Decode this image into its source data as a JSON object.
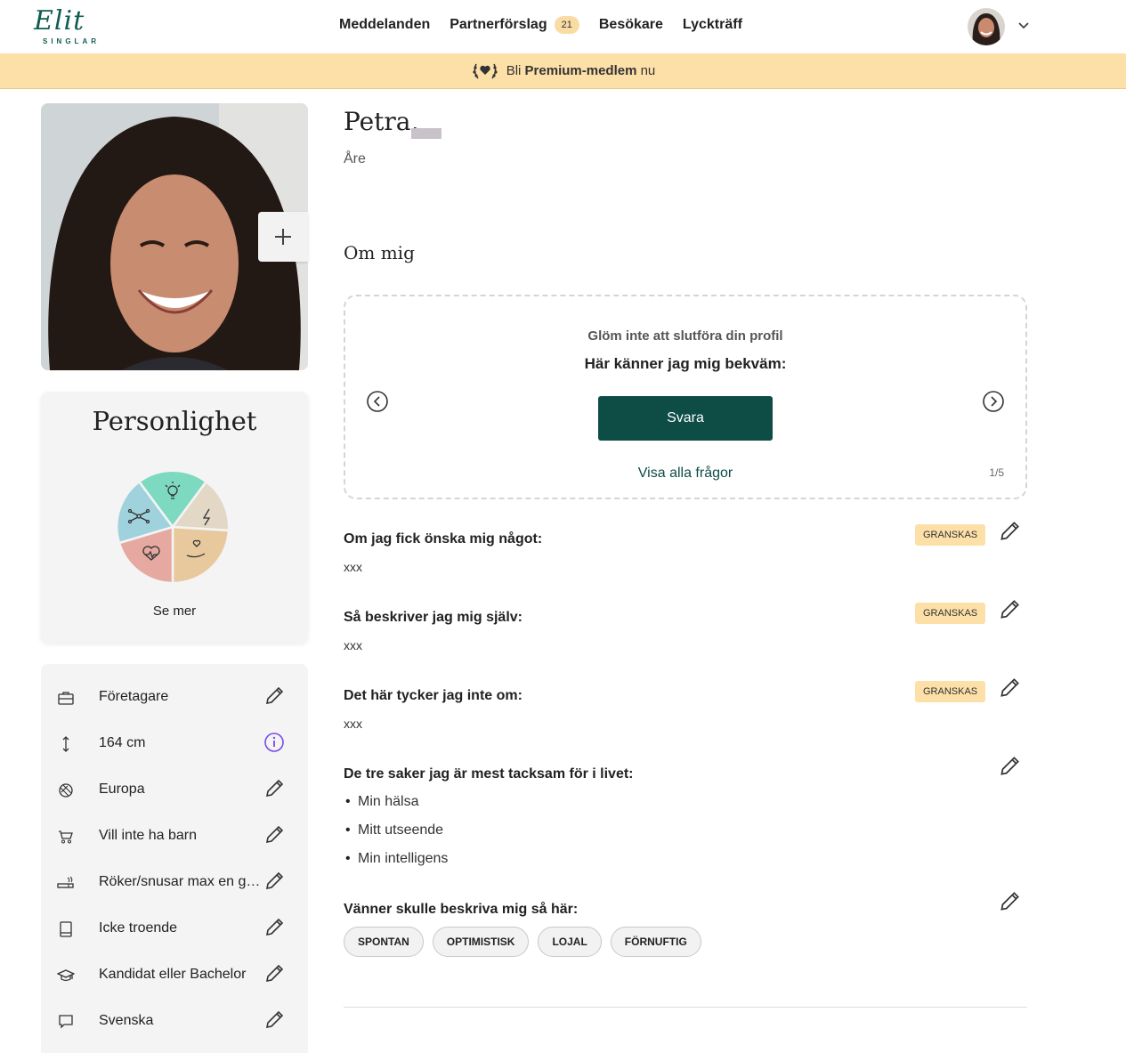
{
  "header": {
    "logo_text": "Elit",
    "logo_sub": "SINGLAR",
    "nav": [
      {
        "label": "Meddelanden"
      },
      {
        "label": "Partnerförslag",
        "badge": "21"
      },
      {
        "label": "Besökare"
      },
      {
        "label": "Lyckträff"
      }
    ]
  },
  "premium": {
    "prefix": "Bli",
    "bold": "Premium-medlem",
    "suffix": "nu"
  },
  "profile": {
    "name": "Petra,",
    "city": "Åre"
  },
  "personality": {
    "title": "Personlighet",
    "see_more": "Se mer"
  },
  "facts": [
    {
      "icon": "briefcase-icon",
      "label": "Företagare",
      "action": "edit"
    },
    {
      "icon": "height-icon",
      "label": "164 cm",
      "action": "info"
    },
    {
      "icon": "globe-icon",
      "label": "Europa",
      "action": "edit"
    },
    {
      "icon": "stroller-icon",
      "label": "Vill inte ha barn",
      "action": "edit"
    },
    {
      "icon": "cigarette-icon",
      "label": "Röker/snusar max en gång i veckan",
      "action": "edit"
    },
    {
      "icon": "book-icon",
      "label": "Icke troende",
      "action": "edit"
    },
    {
      "icon": "graduation-cap-icon",
      "label": "Kandidat eller Bachelor",
      "action": "edit"
    },
    {
      "icon": "speech-bubble-icon",
      "label": "Svenska",
      "action": "edit"
    }
  ],
  "about": {
    "heading": "Om mig",
    "prompt": {
      "subtitle": "Glöm inte att slutföra din profil",
      "question": "Här känner jag mig bekväm:",
      "button": "Svara",
      "show_all": "Visa alla frågor",
      "counter": "1/5"
    },
    "qa": [
      {
        "question": "Om jag fick önska mig något:",
        "answer": "xxx",
        "status": "GRANSKAS"
      },
      {
        "question": "Så beskriver jag mig själv:",
        "answer": "xxx",
        "status": "GRANSKAS"
      },
      {
        "question": "Det här tycker jag inte om:",
        "answer": "xxx",
        "status": "GRANSKAS"
      }
    ],
    "grateful": {
      "question": "De tre saker jag är mest tacksam för i livet:",
      "items": [
        "Min hälsa",
        "Mitt utseende",
        "Min intelligens"
      ]
    },
    "friends": {
      "question": "Vänner skulle beskriva mig så här:",
      "tags": [
        "SPONTAN",
        "OPTIMISTISK",
        "LOJAL",
        "FÖRNUFTIG"
      ]
    }
  },
  "colors": {
    "brand": "#0e4d46",
    "premium_bg": "#fde0a8",
    "pie": [
      "#7dd9c0",
      "#e3d8c6",
      "#e8c99e",
      "#e6a9a1",
      "#9fd2dc"
    ]
  }
}
